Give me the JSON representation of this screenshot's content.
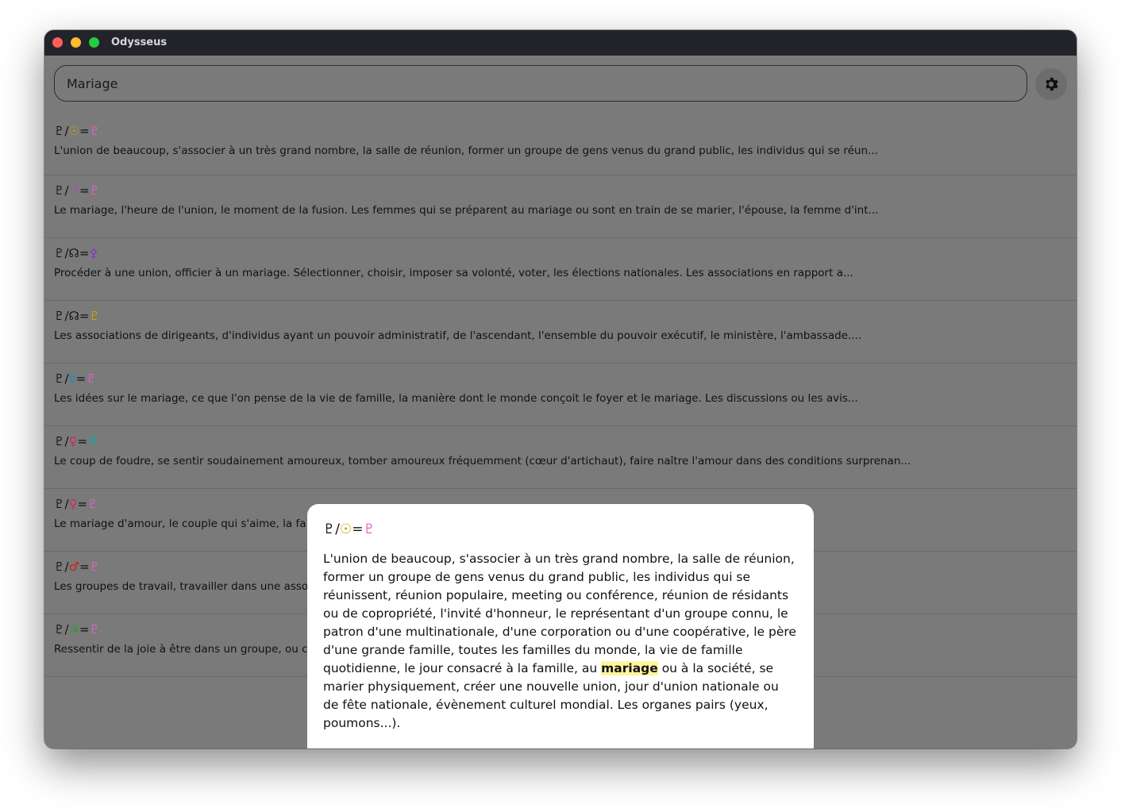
{
  "window": {
    "title": "Odysseus"
  },
  "search": {
    "value": "Mariage",
    "placeholder": ""
  },
  "colors": {
    "pluto": "#111111",
    "sun": "#c9a400",
    "moon": "#b048c0",
    "node": "#111111",
    "mercury": "#1a8fb0",
    "venus": "#d4246c",
    "mars": "#c82020",
    "jupiter": "#2a9d2a",
    "pluto_result": "#e060c8",
    "uranus": "#1fa3a3",
    "sadr": "#8b2fc9",
    "ankh": "#c9a400",
    "highlight": "#fff59d"
  },
  "results": [
    {
      "s1": "♇",
      "s2": "☉",
      "s2c": "#c9a400",
      "s3": "♇",
      "s3c": "#e060c8",
      "desc": "L'union de beaucoup, s'associer à un très grand nombre, la salle de réunion, former un groupe de gens venus du grand public, les individus qui se réun..."
    },
    {
      "s1": "♇",
      "s2": "☽",
      "s2c": "#b048c0",
      "s3": "♇",
      "s3c": "#e060c8",
      "desc": "Le mariage, l'heure de l'union, le moment de la fusion. Les femmes qui se préparent au mariage ou sont en train de se marier, l'épouse, la femme d'int..."
    },
    {
      "s1": "♇",
      "s2": "☊",
      "s2c": "#111111",
      "s3": "⚴",
      "s3c": "#8b2fc9",
      "desc": "Procéder à une union, officier à un mariage. Sélectionner, choisir, imposer sa volonté, voter, les élections nationales. Les associations en rapport a..."
    },
    {
      "s1": "♇",
      "s2": "☊",
      "s2c": "#111111",
      "s3": "♇",
      "s3c": "#c9a400",
      "desc": "Les associations de dirigeants, d'individus ayant un pouvoir administratif, de l'ascendant, l'ensemble du pouvoir exécutif, le ministère, l'ambassade...."
    },
    {
      "s1": "♇",
      "s2": "☿",
      "s2c": "#1a8fb0",
      "s3": "♇",
      "s3c": "#e060c8",
      "desc": "Les idées sur le mariage, ce que l'on pense de la vie de famille, la manière dont le monde conçoit le foyer et le mariage. Les discussions ou les avis..."
    },
    {
      "s1": "♇",
      "s2": "♀",
      "s2c": "#d4246c",
      "s3": "♅",
      "s3c": "#1fa3a3",
      "desc": "Le coup de foudre, se sentir soudainement amoureux, tomber amoureux fréquemment (cœur d'artichaut), faire naître l'amour dans des conditions surprenan..."
    },
    {
      "s1": "♇",
      "s2": "♀",
      "s2c": "#d4246c",
      "s3": "♇",
      "s3c": "#e060c8",
      "desc": "Le mariage d'amour, le couple qui s'aime, la fa                                                                                                                    e accueil..."
    },
    {
      "s1": "♇",
      "s2": "♂",
      "s2c": "#c82020",
      "s3": "♇",
      "s3c": "#e060c8",
      "desc": "Les groupes de travail, travailler dans une asso                                                                                                                  es, le mo..."
    },
    {
      "s1": "♇",
      "s2": "♃",
      "s2c": "#2a9d2a",
      "s3": "♇",
      "s3c": "#e060c8",
      "desc": "Ressentir de la joie à être dans un groupe, ou c                                                                                                                  e pros..."
    }
  ],
  "popup": {
    "s1": "♇",
    "s2": "☉",
    "s2c": "#c9a400",
    "s3": "♇",
    "s3c": "#e060c8",
    "text_before": "L'union de beaucoup, s'associer à un très grand nombre, la salle de réunion, former un groupe de gens venus du grand public, les individus qui se réunissent, réunion populaire, meeting ou conférence, réunion de résidants ou de copropriété, l'invité d'honneur, le représentant d'un groupe connu, le patron d'une multinationale, d'une corporation ou d'une coopérative, le père d'une grande famille, toutes les familles du monde, la vie de famille quotidienne, le jour consacré à la famille, au ",
    "highlight": "mariage",
    "text_after": " ou à la société, se marier physiquement, créer une nouvelle union, jour d'union nationale ou de fête nationale, évènement culturel mondial. Les organes pairs (yeux, poumons...)."
  }
}
